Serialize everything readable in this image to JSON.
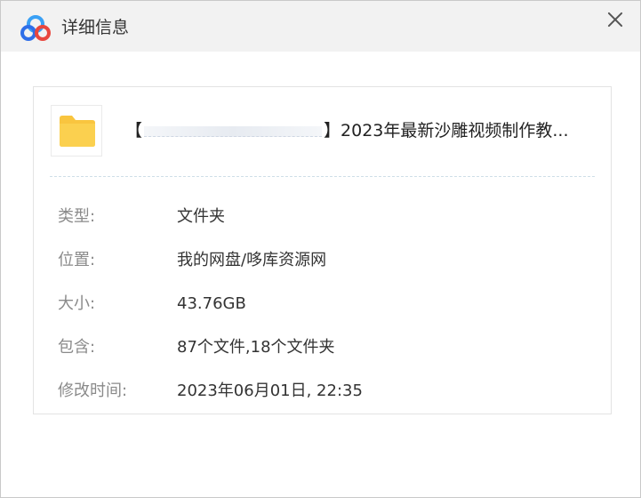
{
  "dialog": {
    "title": "详细信息",
    "close_icon": "close-icon",
    "logo_icon": "baidu-netdisk-logo-icon"
  },
  "file": {
    "icon": "folder-icon",
    "name_prefix": "【",
    "name_suffix": "】2023年最新沙雕视频制作教..."
  },
  "details": [
    {
      "label": "类型:",
      "value": "文件夹"
    },
    {
      "label": "位置:",
      "value": "我的网盘/哆库资源网"
    },
    {
      "label": "大小:",
      "value": "43.76GB"
    },
    {
      "label": "包含:",
      "value": "87个文件,18个文件夹"
    },
    {
      "label": "修改时间:",
      "value": "2023年06月01日, 22:35"
    }
  ],
  "colors": {
    "titlebar_bg": "#f2f2f2",
    "folder_yellow": "#f9c53f",
    "label_gray": "#8a8a8a"
  }
}
